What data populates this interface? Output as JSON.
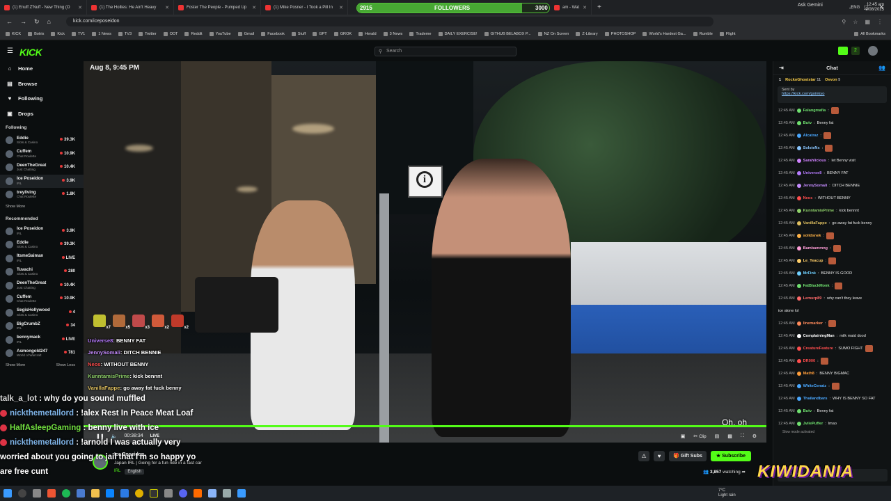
{
  "browser": {
    "tabs": [
      {
        "title": "(1) Enuff Z'Nuff - New Thing (O"
      },
      {
        "title": "(1) The Hollies: He Ain't Heavy"
      },
      {
        "title": "Foster The People - Pumped Up"
      },
      {
        "title": "(1) Mike Posner - I Took a Pill In"
      },
      {
        "title": "am - Wat"
      }
    ],
    "followers_widget": {
      "left": "2915",
      "label": "FOLLOWERS",
      "right": "3000",
      "progress": 0.86
    },
    "gemini": "Ask Gemini",
    "url": "kick.com/iceposeidon",
    "bookmarks": [
      "KICK",
      "Botrix",
      "Kick",
      "TV1",
      "1 News",
      "TV3",
      "Twitter",
      "ODT",
      "Reddit",
      "YouTube",
      "Gmail",
      "Facebook",
      "Stuff",
      "GPT",
      "GROK",
      "Herald",
      "3 News",
      "Trademe",
      "DAILY EXERCISE!",
      "GITHUB BELABOX P...",
      "NZ On Screen",
      "Z-Library",
      "PHOTOSHOP",
      "World's Hardest Ga...",
      "Rumble",
      "Flight",
      "All Bookmarks"
    ]
  },
  "kick": {
    "logo": "KICK",
    "search_placeholder": "Search",
    "header_count": "2"
  },
  "sidebar": {
    "nav": [
      {
        "label": "Home",
        "icon": "home-icon"
      },
      {
        "label": "Browse",
        "icon": "browse-icon"
      },
      {
        "label": "Following",
        "icon": "heart-icon"
      },
      {
        "label": "Drops",
        "icon": "drops-icon"
      }
    ],
    "following_title": "Following",
    "following": [
      {
        "name": "Eddie",
        "cat": "Slots & Casino",
        "viewers": "39.3K"
      },
      {
        "name": "Cuffem",
        "cat": "Chat Roulette",
        "viewers": "10.9K"
      },
      {
        "name": "DeenTheGreat",
        "cat": "Just Chatting",
        "viewers": "10.4K"
      },
      {
        "name": "Ice Poseidon",
        "cat": "IRL",
        "viewers": "3.9K"
      },
      {
        "name": "treyliving",
        "cat": "Chat Roulette",
        "viewers": "1.8K"
      }
    ],
    "show_more": "Show More",
    "recommended_title": "Recommended",
    "recommended": [
      {
        "name": "Ice Poseidon",
        "cat": "IRL",
        "viewers": "3.9K"
      },
      {
        "name": "Eddie",
        "cat": "Slots & Casino",
        "viewers": "39.3K"
      },
      {
        "name": "ItsmeSaiman",
        "cat": "IRL",
        "viewers": "LIVE"
      },
      {
        "name": "Tuvachi",
        "cat": "Slots & Casino",
        "viewers": "280"
      },
      {
        "name": "DeenTheGreat",
        "cat": "Just Chatting",
        "viewers": "10.4K"
      },
      {
        "name": "Cuffem",
        "cat": "Chat Roulette",
        "viewers": "10.9K"
      },
      {
        "name": "SegisHollywood",
        "cat": "Slots & Casino",
        "viewers": "4"
      },
      {
        "name": "BigCrumbZ",
        "cat": "IRL",
        "viewers": "34"
      },
      {
        "name": "bennymack",
        "cat": "IRL",
        "viewers": "LIVE"
      },
      {
        "name": "Asmongold247",
        "cat": "World of Warcraft",
        "viewers": "781"
      }
    ],
    "show_more2": "Show More",
    "show_less": "Show Less"
  },
  "video": {
    "datestamp": "Aug 8, 9:45 PM",
    "emote_counts": [
      "x7",
      "x5",
      "x3",
      "x2",
      "x2"
    ],
    "overlay_chat": [
      {
        "user": "Universe8",
        "msg": "BENNY FAT",
        "color": "#b77cff"
      },
      {
        "user": "JennySomali",
        "msg": "DITCH BENNIE",
        "color": "#c58cff"
      },
      {
        "user": "Neos",
        "msg": "WITHOUT BENNY",
        "color": "#ff4d4d"
      },
      {
        "user": "KunntamisPrime",
        "msg": "kick bennnt",
        "color": "#8fd16a"
      },
      {
        "user": "VanillaFappe",
        "msg": "go away fat fuck benny",
        "color": "#e0c060"
      }
    ],
    "caption": "Oh, oh",
    "time": "00:38:34",
    "live": "LIVE",
    "clip": "Clip",
    "progress": 1.0
  },
  "big_chat": [
    {
      "user": "talk_a_lot",
      "msg": " : why do you sound muffled"
    },
    {
      "user": "nickthemetallord",
      "msg": " : !alex Rest In Peace Meat Loaf"
    },
    {
      "user": "HalfAsleepGaming",
      "msg": " : benny live with ice"
    },
    {
      "user": "nickthemetallord",
      "msg": " : !arnold I was actually very"
    },
    {
      "user": "",
      "msg": "worried about you going to jail that I'm so happy yo"
    },
    {
      "user": "",
      "msg": "are free cunt"
    }
  ],
  "stream": {
    "streamer": "Ice Poseidon",
    "title": "Japan IRL | Going for a fun ride in a fast car",
    "category": "IRL",
    "language": "English",
    "gift_subs": "Gift Subs",
    "subscribe": "Subscribe",
    "watching": "3,857",
    "watching_label": "watching"
  },
  "chat": {
    "title": "Chat",
    "gifters": [
      {
        "rank": "1",
        "name": "RockoGhoststar",
        "count": "11"
      },
      {
        "rank": "",
        "name": "Ovvon",
        "count": "5"
      }
    ],
    "pinned_sender": "Sent by",
    "pinned_link": "https://kick.com/goinkyo",
    "messages": [
      {
        "time": "12:45 AM",
        "user": "Falangmafia",
        "msg": "",
        "color": "#6fe06f",
        "emote": true
      },
      {
        "time": "12:45 AM",
        "user": "Butv",
        "msg": "Benny fat",
        "color": "#6fe06f",
        "emote": false
      },
      {
        "time": "12:45 AM",
        "user": "Alcatraz",
        "msg": "",
        "color": "#4aa8ff",
        "emote": true
      },
      {
        "time": "12:45 AM",
        "user": "SolsteNx",
        "msg": "",
        "color": "#8ac6ff",
        "emote": true
      },
      {
        "time": "12:45 AM",
        "user": "Sarahlicious",
        "msg": "let Benny visit",
        "color": "#d183ff",
        "emote": false
      },
      {
        "time": "12:45 AM",
        "user": "Universe8",
        "msg": "BENNY FAT",
        "color": "#b77cff",
        "emote": false
      },
      {
        "time": "12:45 AM",
        "user": "JennySomali",
        "msg": "DITCH BENNIE",
        "color": "#c58cff",
        "emote": false
      },
      {
        "time": "12:45 AM",
        "user": "Neos",
        "msg": "WITHOUT BENNY",
        "color": "#ff4d4d",
        "emote": false
      },
      {
        "time": "12:45 AM",
        "user": "KunntamisPrime",
        "msg": "kick bennnt",
        "color": "#8fd16a",
        "emote": false
      },
      {
        "time": "12:45 AM",
        "user": "VanillaFappe",
        "msg": "go away fat fuck benny",
        "color": "#e0c060",
        "emote": false
      },
      {
        "time": "12:45 AM",
        "user": "solidsnek",
        "msg": "",
        "color": "#ffb347",
        "emote": true
      },
      {
        "time": "12:45 AM",
        "user": "Bambammng",
        "msg": "",
        "color": "#ff9ed8",
        "emote": true
      },
      {
        "time": "12:45 AM",
        "user": "Le_Teacup",
        "msg": "",
        "color": "#ffcf6a",
        "emote": true
      },
      {
        "time": "12:45 AM",
        "user": "MrFink",
        "msg": "BENNY IS GOOD",
        "color": "#6fd0ff",
        "emote": false
      },
      {
        "time": "12:45 AM",
        "user": "FatBlackMonk",
        "msg": "",
        "color": "#6fe06f",
        "emote": true
      },
      {
        "time": "12:45 AM",
        "user": "Lemurp89",
        "msg": "why can't they leave",
        "color": "#ff6a6a",
        "emote": false
      },
      {
        "time": "",
        "user": "",
        "msg": "ice alone lol",
        "color": "#ffffff",
        "emote": false
      },
      {
        "time": "12:45 AM",
        "user": "linemarker",
        "msg": "",
        "color": "#ff8a5a",
        "emote": true
      },
      {
        "time": "12:45 AM",
        "user": "ComplainingMan",
        "msg": "milk maid dood",
        "color": "#ffffff",
        "emote": false
      },
      {
        "time": "12:45 AM",
        "user": "CreatureFeature",
        "msg": "SUMO FIGHT",
        "color": "#ff4d4d",
        "emote": true
      },
      {
        "time": "12:45 AM",
        "user": "DR000",
        "msg": "",
        "color": "#ff4d4d",
        "emote": true
      },
      {
        "time": "12:45 AM",
        "user": "Math8",
        "msg": "BENNY BIGMAC",
        "color": "#ff9d3a",
        "emote": false
      },
      {
        "time": "12:45 AM",
        "user": "WhiteCenatz",
        "msg": "",
        "color": "#4aa8ff",
        "emote": true
      },
      {
        "time": "12:45 AM",
        "user": "Thailandbars",
        "msg": "WHY IS BENNY SO FAT",
        "color": "#4aa8ff",
        "emote": false
      },
      {
        "time": "12:45 AM",
        "user": "Butv",
        "msg": "Benny fat",
        "color": "#6fe06f",
        "emote": false
      },
      {
        "time": "12:45 AM",
        "user": "JvilePuffer",
        "msg": "lmao",
        "color": "#6fe06f",
        "emote": false
      }
    ],
    "slow_mode": "Slow mode activated",
    "input_placeholder": "Send a message"
  },
  "overlay_wordmark": "KIWIDANIA",
  "taskbar": {
    "weather_temp": "7°C",
    "weather_desc": "Light rain",
    "lang": "ENG",
    "time": "12:45 am",
    "date": "9/08/2025"
  }
}
